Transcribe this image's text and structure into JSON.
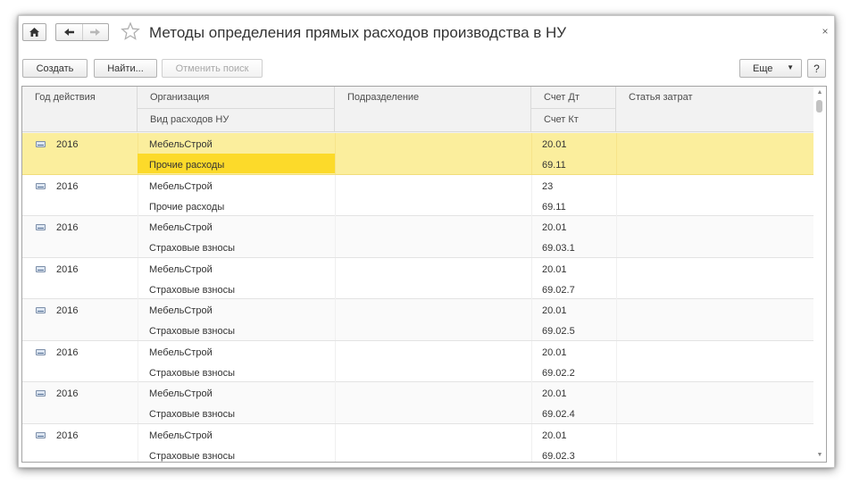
{
  "window": {
    "title": "Методы определения прямых расходов производства в НУ",
    "close_glyph": "×",
    "home_icon": "home-icon",
    "back_icon": "arrow-left-icon",
    "forward_icon": "arrow-right-icon",
    "favorite_icon": "star-icon"
  },
  "toolbar": {
    "create_label": "Создать",
    "find_label": "Найти...",
    "cancel_search_label": "Отменить поиск",
    "more_label": "Еще",
    "more_caret": "▼",
    "help_label": "?"
  },
  "table": {
    "headers": {
      "year": "Год действия",
      "organization": "Организация",
      "expense_type": "Вид расходов НУ",
      "subdivision": "Подразделение",
      "account_dt": "Счет Дт",
      "account_kt": "Счет Кт",
      "cost_item": "Статья затрат"
    },
    "rows": [
      {
        "year": "2016",
        "organization": "МебельСтрой",
        "expense_type": "Прочие расходы",
        "account_dt": "20.01",
        "account_kt": "69.11",
        "selected": true
      },
      {
        "year": "2016",
        "organization": "МебельСтрой",
        "expense_type": "Прочие расходы",
        "account_dt": "23",
        "account_kt": "69.11"
      },
      {
        "year": "2016",
        "organization": "МебельСтрой",
        "expense_type": "Страховые взносы",
        "account_dt": "20.01",
        "account_kt": "69.03.1"
      },
      {
        "year": "2016",
        "organization": "МебельСтрой",
        "expense_type": "Страховые взносы",
        "account_dt": "20.01",
        "account_kt": "69.02.7"
      },
      {
        "year": "2016",
        "organization": "МебельСтрой",
        "expense_type": "Страховые взносы",
        "account_dt": "20.01",
        "account_kt": "69.02.5"
      },
      {
        "year": "2016",
        "organization": "МебельСтрой",
        "expense_type": "Страховые взносы",
        "account_dt": "20.01",
        "account_kt": "69.02.2"
      },
      {
        "year": "2016",
        "organization": "МебельСтрой",
        "expense_type": "Страховые взносы",
        "account_dt": "20.01",
        "account_kt": "69.02.4"
      },
      {
        "year": "2016",
        "organization": "МебельСтрой",
        "expense_type": "Страховые взносы",
        "account_dt": "20.01",
        "account_kt": "69.02.3"
      }
    ],
    "row_icon": "record-icon",
    "scroll_up_glyph": "▲",
    "scroll_down_glyph": "▼"
  },
  "colors": {
    "selected_row": "#fbee9d",
    "selected_cell": "#fcda2a"
  }
}
